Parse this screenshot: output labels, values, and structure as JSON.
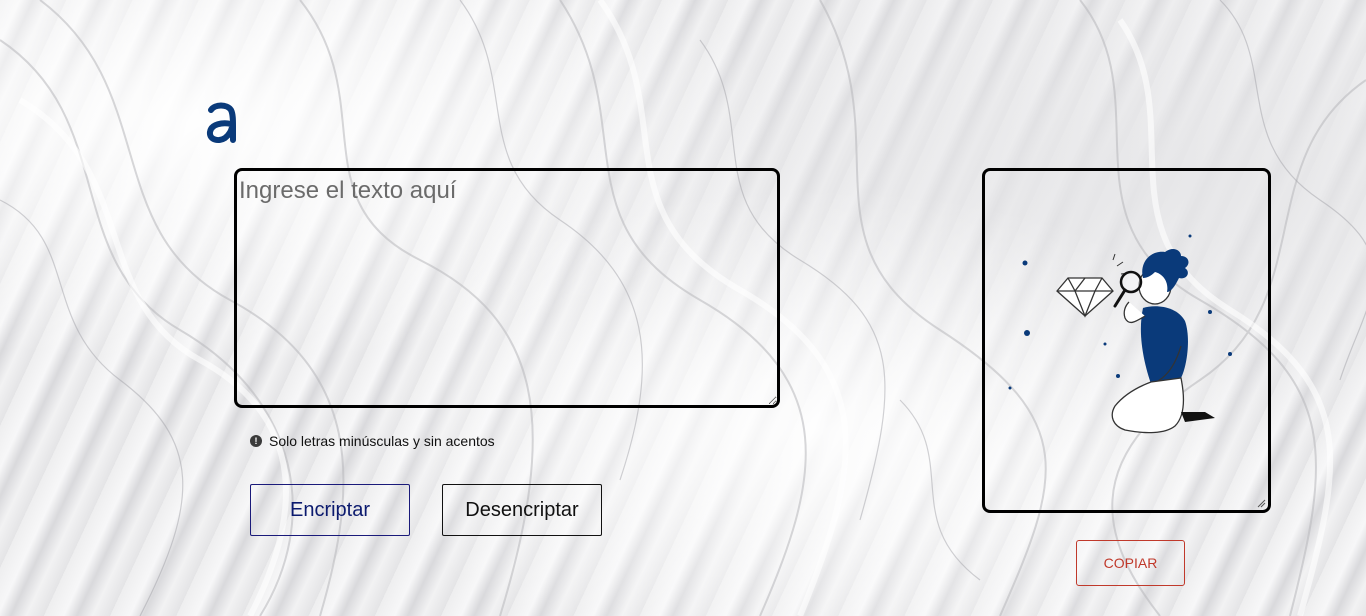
{
  "input": {
    "placeholder": "Ingrese el texto aquí",
    "value": ""
  },
  "hint": {
    "icon": "info-icon",
    "text": "Solo letras minúsculas y sin acentos"
  },
  "buttons": {
    "encrypt": "Encriptar",
    "decrypt": "Desencriptar",
    "copy": "COPIAR"
  },
  "output": {
    "illustration": "person-with-magnifying-glass-and-diamond"
  },
  "colors": {
    "brand": "#0a3a7a",
    "encrypt_text": "#0b1a6e",
    "copy_accent": "#c0392b"
  }
}
